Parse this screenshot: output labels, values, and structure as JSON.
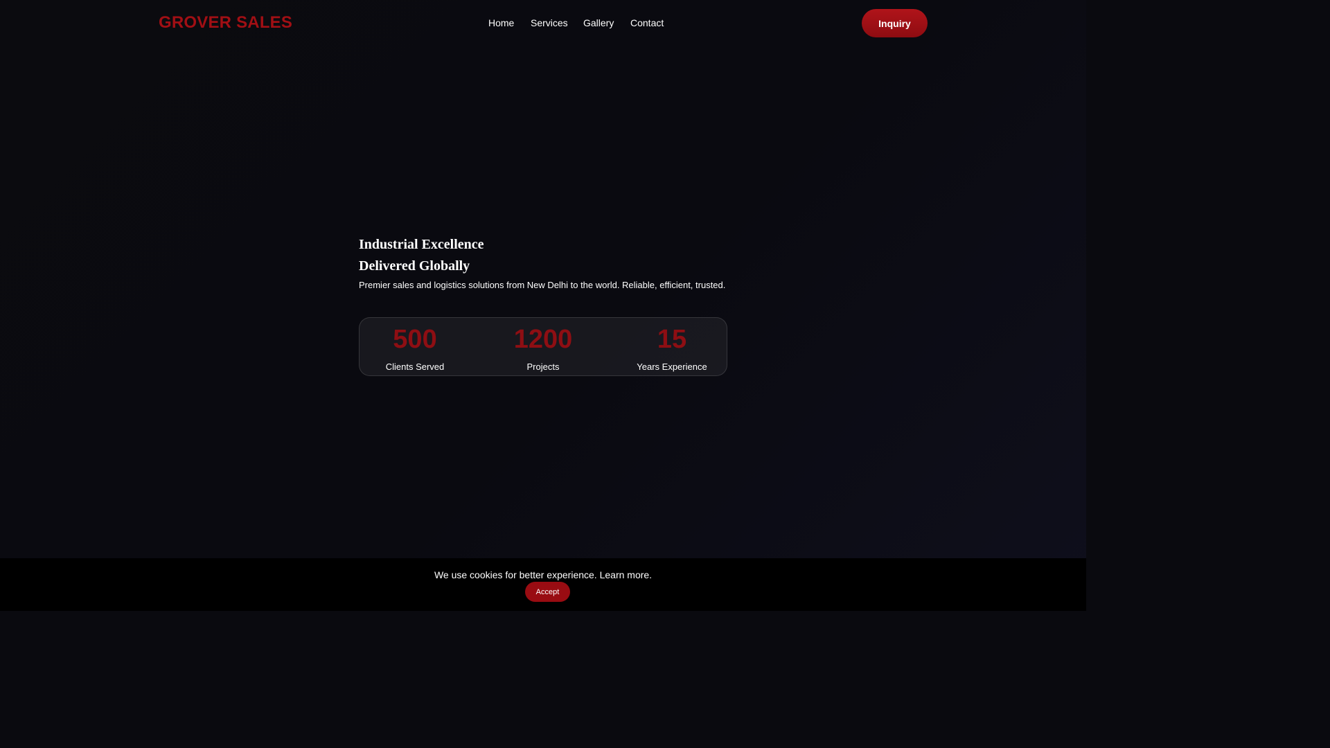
{
  "brand": {
    "name": "GROVER SALES",
    "accent_color": "#a10f14"
  },
  "nav": {
    "items": [
      {
        "label": "Home"
      },
      {
        "label": "Services"
      },
      {
        "label": "Gallery"
      },
      {
        "label": "Contact"
      }
    ],
    "cta_label": "Inquiry"
  },
  "hero": {
    "title_line1": "Industrial Excellence",
    "title_line2": "Delivered Globally",
    "subtitle": "Premier sales and logistics solutions from New Delhi to the world. Reliable, efficient, trusted."
  },
  "stats": [
    {
      "value": "500",
      "label": "Clients Served"
    },
    {
      "value": "1200",
      "label": "Projects"
    },
    {
      "value": "15",
      "label": "Years Experience"
    }
  ],
  "cookie_banner": {
    "message": "We use cookies for better experience. Learn more.",
    "accept_label": "Accept"
  }
}
